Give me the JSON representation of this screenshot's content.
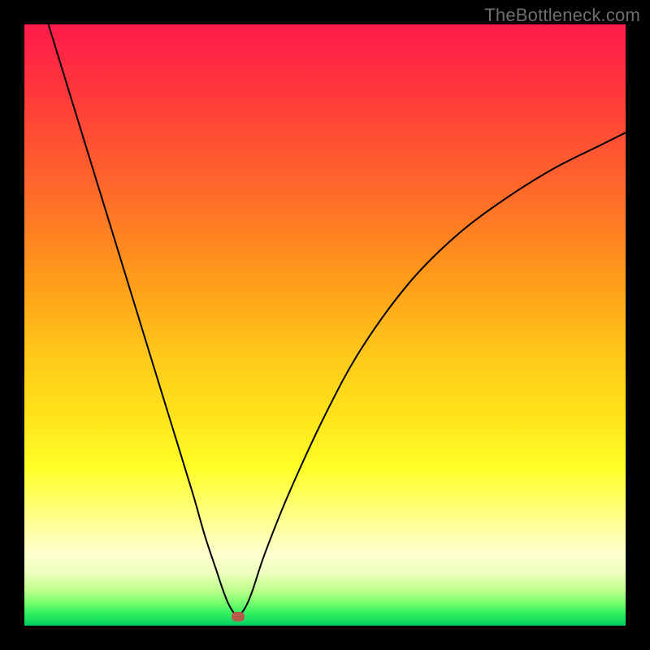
{
  "watermark": "TheBottleneck.com",
  "chart_data": {
    "type": "line",
    "title": "",
    "xlabel": "",
    "ylabel": "",
    "xlim": [
      0,
      100
    ],
    "ylim": [
      0,
      100
    ],
    "grid": false,
    "series": [
      {
        "name": "curve",
        "color": "#000000",
        "x": [
          4,
          8,
          12,
          16,
          20,
          24,
          28,
          30,
          32,
          33,
          34,
          35,
          36,
          37,
          38,
          40,
          44,
          50,
          56,
          64,
          72,
          80,
          88,
          96,
          100
        ],
        "y": [
          100,
          87,
          74,
          61,
          48,
          35,
          22,
          15,
          9,
          6,
          3.5,
          2,
          2,
          3.5,
          6,
          12,
          22,
          35,
          46,
          57,
          65,
          71,
          76,
          80,
          82
        ]
      }
    ],
    "marker": {
      "x": 35.5,
      "y": 1.5,
      "color": "#b65a4a"
    },
    "background": "rainbow-gradient-vertical"
  }
}
